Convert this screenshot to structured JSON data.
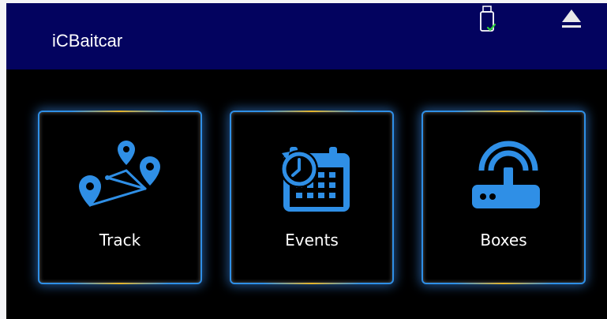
{
  "header": {
    "title": "iCBaitcar",
    "icons": [
      "usb-drive-connected-icon",
      "eject-icon"
    ]
  },
  "tiles": [
    {
      "label": "Track",
      "icon": "map-route-pins-icon"
    },
    {
      "label": "Events",
      "icon": "calendar-history-icon"
    },
    {
      "label": "Boxes",
      "icon": "wifi-router-icon"
    }
  ],
  "colors": {
    "header_bg": "#03035f",
    "screen_bg": "#000000",
    "accent_blue": "#2f8fe6",
    "accent_gold": "#e6b428",
    "check_green": "#2fd13a"
  }
}
